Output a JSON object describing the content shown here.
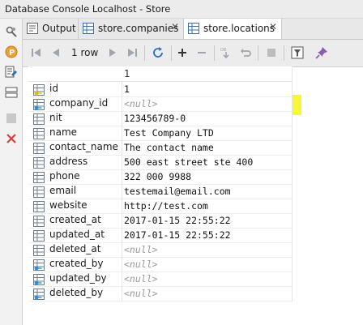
{
  "window": {
    "title": "Database Console Localhost - Store"
  },
  "tabs": [
    {
      "label": "Output",
      "icon": "output-icon",
      "active": false,
      "closable": false
    },
    {
      "label": "store.companies",
      "icon": "table-icon",
      "active": false,
      "closable": true
    },
    {
      "label": "store.locations",
      "icon": "table-icon",
      "active": true,
      "closable": true
    }
  ],
  "toolbar": {
    "row_count": "1 row",
    "buttons": [
      "first-page-icon",
      "previous-page-icon",
      "next-page-icon",
      "last-page-icon",
      "refresh-icon",
      "add-row-icon",
      "delete-row-icon",
      "submit-icon",
      "revert-icon",
      "stop-icon",
      "filter-icon",
      "pin-icon"
    ]
  },
  "grid": {
    "header": "1",
    "rows": [
      {
        "field": "id",
        "value": "1",
        "is_null": false,
        "icon": "primary-key-column-icon"
      },
      {
        "field": "company_id",
        "value": "<null>",
        "is_null": true,
        "icon": "foreign-key-column-icon",
        "highlighted": true
      },
      {
        "field": "nit",
        "value": "123456789-0",
        "is_null": false,
        "icon": "column-icon"
      },
      {
        "field": "name",
        "value": "Test Company LTD",
        "is_null": false,
        "icon": "column-icon"
      },
      {
        "field": "contact_name",
        "value": "The contact name",
        "is_null": false,
        "icon": "column-icon"
      },
      {
        "field": "address",
        "value": "500 east street ste 400",
        "is_null": false,
        "icon": "column-icon"
      },
      {
        "field": "phone",
        "value": "322 000 9988",
        "is_null": false,
        "icon": "column-icon"
      },
      {
        "field": "email",
        "value": "testemail@email.com",
        "is_null": false,
        "icon": "column-icon"
      },
      {
        "field": "website",
        "value": "http://test.com",
        "is_null": false,
        "icon": "column-icon"
      },
      {
        "field": "created_at",
        "value": "2017-01-15 22:55:22",
        "is_null": false,
        "icon": "column-icon"
      },
      {
        "field": "updated_at",
        "value": "2017-01-15 22:55:22",
        "is_null": false,
        "icon": "column-icon"
      },
      {
        "field": "deleted_at",
        "value": "<null>",
        "is_null": true,
        "icon": "column-icon"
      },
      {
        "field": "created_by",
        "value": "<null>",
        "is_null": true,
        "icon": "foreign-key-column-icon"
      },
      {
        "field": "updated_by",
        "value": "<null>",
        "is_null": true,
        "icon": "foreign-key-column-icon"
      },
      {
        "field": "deleted_by",
        "value": "<null>",
        "is_null": true,
        "icon": "foreign-key-column-icon"
      }
    ]
  },
  "colors": {
    "highlight": "#f5f51a",
    "null_text": "#9a9a9a",
    "accent": "#2a6fb8"
  }
}
